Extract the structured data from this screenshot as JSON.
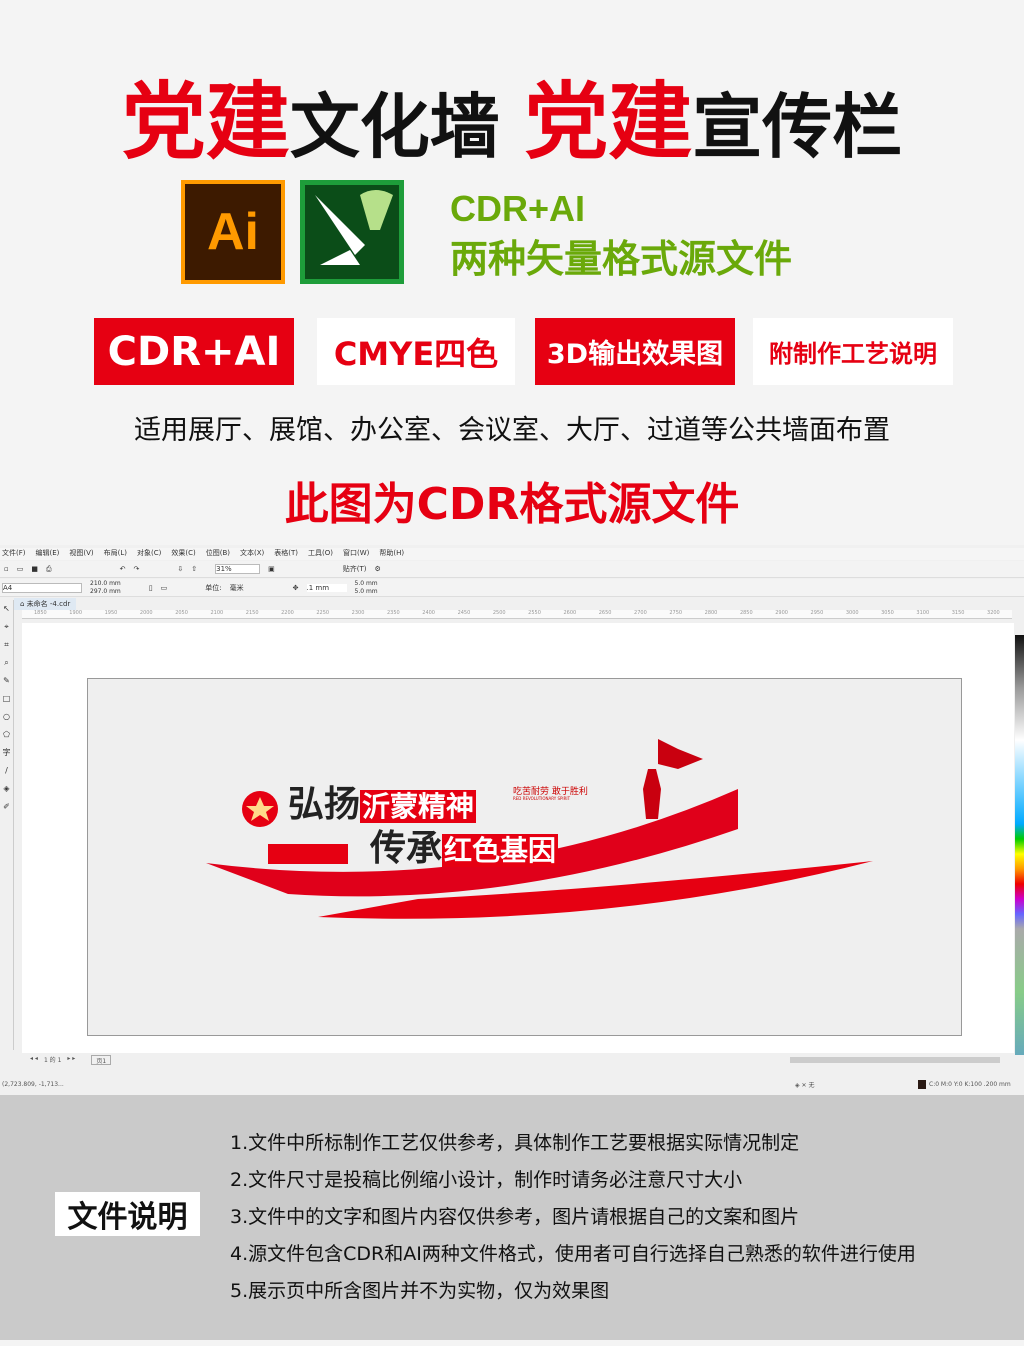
{
  "header": {
    "title_red_1": "党建",
    "title_black_1": "文化墙",
    "title_red_2": "党建",
    "title_black_2": "宣传栏"
  },
  "logos": {
    "ai_label": "Ai",
    "ai_color": "#ff9a00",
    "cdr_color": "#1e9d3a"
  },
  "formats": {
    "line1": "CDR+AI",
    "line2": "两种矢量格式源文件"
  },
  "badges": [
    "CDR+AI",
    "CMYE四色",
    "3D输出效果图",
    "附制作工艺说明"
  ],
  "subtitle": "适用展厅、展馆、办公室、会议室、大厅、过道等公共墙面布置",
  "source_note": "此图为CDR格式源文件",
  "app": {
    "menu": [
      "文件(F)",
      "编辑(E)",
      "视图(V)",
      "布局(L)",
      "对象(C)",
      "效果(C)",
      "位图(B)",
      "文本(X)",
      "表格(T)",
      "工具(O)",
      "窗口(W)",
      "帮助(H)"
    ],
    "zoom": "31%",
    "snap": "贴齐(T)",
    "page_size": "A4",
    "width": "210.0 mm",
    "height": "297.0 mm",
    "unit_label": "单位:",
    "unit": "毫米",
    "nudge": ".1 mm",
    "dup_x": "5.0 mm",
    "dup_y": "5.0 mm",
    "tab": "未命名 -4.cdr",
    "ruler": [
      "1850",
      "1900",
      "1950",
      "2000",
      "2050",
      "2100",
      "2150",
      "2200",
      "2250",
      "2300",
      "2350",
      "2400",
      "2450",
      "2500",
      "2550",
      "2600",
      "2650",
      "2700",
      "2750",
      "2800",
      "2850",
      "2900",
      "2950",
      "3000",
      "3050",
      "3100",
      "3150",
      "3200"
    ],
    "page_nav": "1 的 1",
    "page_tab": "页1",
    "coords": "(2,723.809, -1,713...",
    "fill_none": "无",
    "color_info": "C:0 M:0 Y:0 K:100  .200 mm",
    "artwork": {
      "line1a": "弘扬",
      "line1b": "沂蒙精神",
      "line2a": "传承",
      "line2b": "红色基因",
      "motto": "吃苦耐劳 敢于胜利",
      "motto_en": "RED REVOLUTIONARY SPIRIT"
    }
  },
  "docs": {
    "label": "文件说明",
    "items": [
      "1.文件中所标制作工艺仅供参考，具体制作工艺要根据实际情况制定",
      "2.文件尺寸是投稿比例缩小设计，制作时请务必注意尺寸大小",
      "3.文件中的文字和图片内容仅供参考，图片请根据自己的文案和图片",
      "4.源文件包含CDR和AI两种文件格式，使用者可自行选择自己熟悉的软件进行使用",
      "5.展示页中所含图片并不为实物，仅为效果图"
    ]
  }
}
